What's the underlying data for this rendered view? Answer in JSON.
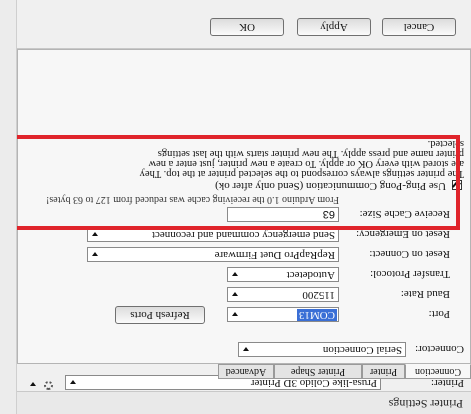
{
  "window": {
    "title": "Printer Settings"
  },
  "printer": {
    "label": "Printer:",
    "selected": "Prusa-like Colido 3D Printer",
    "settings_icon": "gear-icon",
    "dropdown_icon": "chevron-down-icon"
  },
  "tabs": [
    {
      "label": "Connection",
      "active": true
    },
    {
      "label": "Printer"
    },
    {
      "label": "Printer Shape"
    },
    {
      "label": "Advanced"
    }
  ],
  "connection": {
    "connector_label": "Connector:",
    "connector_value": "Serial Connection",
    "port_label": "Port:",
    "port_value": "COM13",
    "refresh_ports_label": "Refresh Ports",
    "baud_label": "Baud Rate:",
    "baud_value": "115200",
    "protocol_label": "Transfer Protocol:",
    "protocol_value": "Autodetect",
    "reset_connect_label": "Reset on Connect:",
    "reset_connect_value": "RepRapPro Duet Firmware",
    "reset_emergency_label": "Reset on Emergency:",
    "reset_emergency_value": "Send emergency command and reconnect",
    "cache_label": "Receive Cache Size:",
    "cache_value": "63",
    "cache_note": "From Arduino 1.0 the receiving cache was reduced from 127 to 63 bytes!",
    "pingpong_label": "Use Ping-Pong Communication (Send only after ok)",
    "pingpong_checked": true
  },
  "info_lines": [
    "The printer settings always correspond to the selected printer at the top. They",
    "are stored with every OK or apply. To create a new printer, just enter a new",
    "printer name and press apply. The new printer starts with the last settings",
    "selected."
  ],
  "buttons": {
    "ok": "OK",
    "apply": "Apply",
    "cancel": "Cancel"
  },
  "colors": {
    "highlight_box": "#e0242b",
    "selection": "#3a6fd6"
  }
}
